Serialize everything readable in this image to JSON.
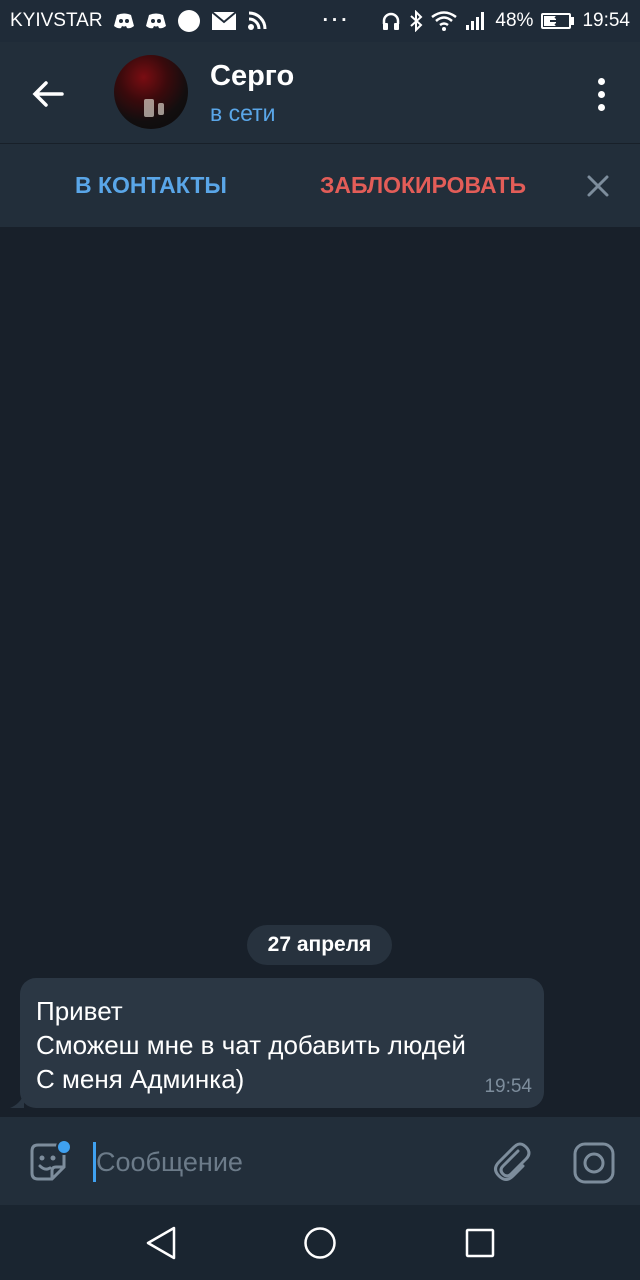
{
  "status_bar": {
    "carrier": "KYIVSTAR",
    "more": "···",
    "battery": "48%",
    "time": "19:54",
    "icons": [
      "discord-icon",
      "discord-icon",
      "circle-app-icon",
      "mail-icon",
      "rss-icon",
      "headphones-icon",
      "bluetooth-icon",
      "wifi-icon",
      "signal-icon",
      "battery-icon"
    ]
  },
  "header": {
    "name": "Серго",
    "status": "в сети"
  },
  "action_bar": {
    "add_contact": "В КОНТАКТЫ",
    "block": "ЗАБЛОКИРОВАТЬ"
  },
  "chat": {
    "date": "27 апреля",
    "message": {
      "lines": [
        "Привет",
        "Сможеш мне в чат добавить людей",
        "С меня Админка)"
      ],
      "time": "19:54"
    }
  },
  "composer": {
    "placeholder": "Сообщение"
  },
  "colors": {
    "accent_blue": "#5aa6e8",
    "danger_red": "#e35d58",
    "background": "#18202a",
    "panel": "#222e3a",
    "bubble": "#2b3744"
  }
}
